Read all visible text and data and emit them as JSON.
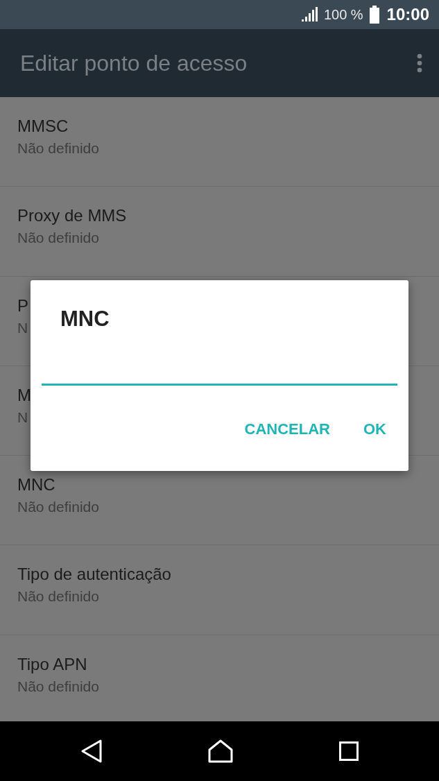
{
  "status_bar": {
    "battery": "100 %",
    "time": "10:00"
  },
  "app_bar": {
    "title": "Editar ponto de acesso"
  },
  "settings": [
    {
      "title": "MMSC",
      "summary": "Não definido"
    },
    {
      "title": "Proxy de MMS",
      "summary": "Não definido"
    },
    {
      "title": "P",
      "summary": "N"
    },
    {
      "title": "M",
      "summary": "N"
    },
    {
      "title": "MNC",
      "summary": "Não definido"
    },
    {
      "title": "Tipo de autenticação",
      "summary": "Não definido"
    },
    {
      "title": "Tipo APN",
      "summary": "Não definido"
    }
  ],
  "dialog": {
    "title": "MNC",
    "buttons": [
      "CANCELAR",
      "OK"
    ]
  }
}
